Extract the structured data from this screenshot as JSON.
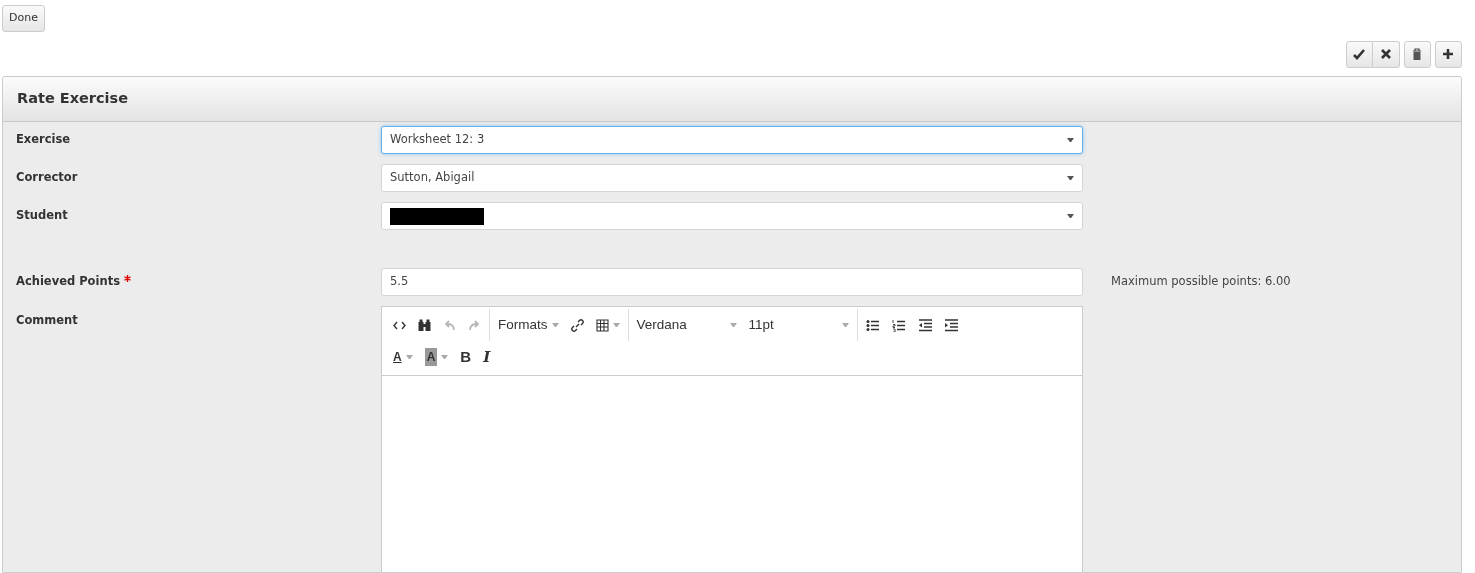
{
  "done_button": "Done",
  "actions": [
    {
      "kind": "check"
    },
    {
      "kind": "cross"
    },
    {
      "kind": "trash"
    },
    {
      "kind": "plus"
    }
  ],
  "panel": {
    "title": "Rate Exercise"
  },
  "fields": [
    {
      "kind": "select",
      "label": "Exercise",
      "value": "Worksheet 12: 3",
      "focused": true,
      "required": false,
      "redacted": false
    },
    {
      "kind": "select",
      "label": "Corrector",
      "value": "Sutton, Abigail",
      "focused": false,
      "required": false,
      "redacted": false
    },
    {
      "kind": "select",
      "label": "Student",
      "focused": false,
      "required": false,
      "redacted": true
    },
    {
      "kind": "input",
      "label": "Achieved Points",
      "value": "5.5",
      "focused": false,
      "required": true,
      "redacted": false,
      "hint": "Maximum possible points: 6.00"
    }
  ],
  "comment": {
    "label": "Comment",
    "toolbar_rows": [
      [
        [
          {
            "kind": "code",
            "disabled": false
          },
          {
            "kind": "find",
            "disabled": false
          },
          {
            "kind": "undo",
            "disabled": true
          },
          {
            "kind": "redo",
            "disabled": true
          }
        ],
        [
          {
            "kind": "menu",
            "text": "Formats",
            "disabled": false
          },
          {
            "kind": "link",
            "disabled": false
          },
          {
            "kind": "table",
            "disabled": false
          }
        ],
        [
          {
            "kind": "select",
            "text": "Verdana",
            "disabled": false
          },
          {
            "kind": "select",
            "text": "11pt",
            "disabled": false
          }
        ],
        [
          {
            "kind": "bullist",
            "disabled": false
          },
          {
            "kind": "numlist",
            "disabled": false
          },
          {
            "kind": "outdent",
            "disabled": false
          },
          {
            "kind": "indent",
            "disabled": false
          }
        ]
      ],
      [
        [
          {
            "kind": "forecolor",
            "text": "A",
            "disabled": false
          },
          {
            "kind": "backcolor",
            "text": "A",
            "disabled": false
          },
          {
            "kind": "bold",
            "text": "B",
            "disabled": false
          },
          {
            "kind": "italic",
            "text": "I",
            "disabled": false
          }
        ]
      ]
    ]
  }
}
